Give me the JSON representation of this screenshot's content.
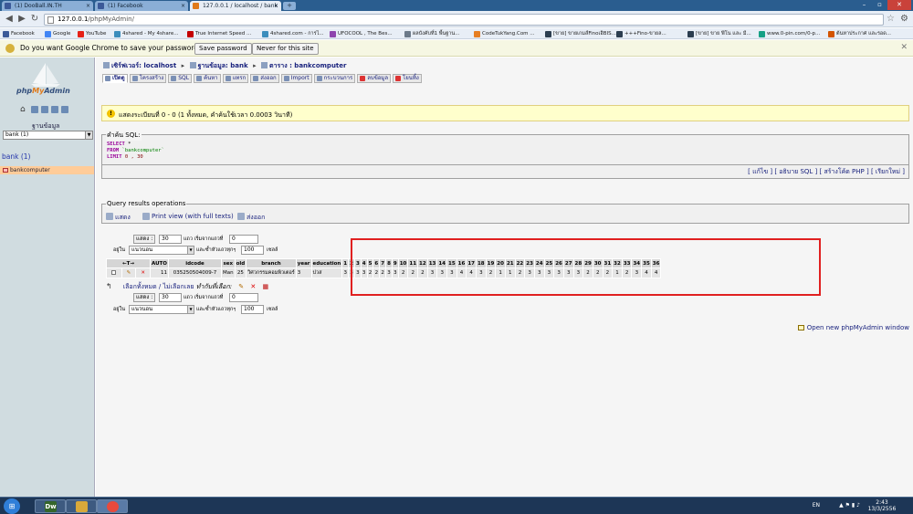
{
  "browser": {
    "tabs": [
      {
        "label": "(1) DooBall.IN.TH",
        "fav": "#3b5998",
        "active": false
      },
      {
        "label": "(1) Facebook",
        "fav": "#3b5998",
        "active": false
      },
      {
        "label": "127.0.0.1 / localhost / bank",
        "fav": "#e07a1a",
        "active": true
      }
    ],
    "url_host": "127.0.0.1",
    "url_path": "/phpMyAdmin/",
    "bookmarks": [
      {
        "label": "Facebook",
        "color": "#3b5998"
      },
      {
        "label": "Google",
        "color": "#4285f4"
      },
      {
        "label": "YouTube",
        "color": "#e62117"
      },
      {
        "label": "4shared - My 4share...",
        "color": "#3c8dbc"
      },
      {
        "label": "True Internet Speed ...",
        "color": "#c40000"
      },
      {
        "label": "4shared.com - การไ...",
        "color": "#3c8dbc"
      },
      {
        "label": "UFOCOOL , The Bes...",
        "color": "#8e44ad"
      },
      {
        "label": "ผลบังคับที่1 พื้นฐาน...",
        "color": "#6c7a89"
      },
      {
        "label": "CodeTukYang.Com ...",
        "color": "#e67e22"
      },
      {
        "label": "[ขาย] ขายเกมส์FinoเฮิBIS...",
        "color": "#2c3e50"
      },
      {
        "label": "+++Fino-ขายล...",
        "color": "#2c3e50"
      },
      {
        "label": "[ขาย] ขาย ฟีโน และ มี...",
        "color": "#2c3e50"
      },
      {
        "label": "www.0-pin.com/0-p...",
        "color": "#16a085"
      },
      {
        "label": "ต้นหาประกาศ และรอด...",
        "color": "#d35400"
      }
    ],
    "infobar": {
      "message": "Do you want Google Chrome to save your password?",
      "save_label": "Save password",
      "never_label": "Never for this site"
    }
  },
  "sidebar": {
    "logo_php": "php",
    "logo_my": "My",
    "logo_admin": "Admin",
    "db_label": "ฐานข้อมูล",
    "db_select_value": "bank (1)",
    "db_link": "bank (1)",
    "table_link": "bankcomputer"
  },
  "breadcrumb": {
    "server": "เซิร์ฟเวอร์: localhost",
    "database": "ฐานข้อมูล: bank",
    "table": "ตาราง : bankcomputer"
  },
  "tabs": [
    {
      "label": "เปิดดู",
      "active": true
    },
    {
      "label": "โครงสร้าง",
      "active": false
    },
    {
      "label": "SQL",
      "active": false
    },
    {
      "label": "ค้นหา",
      "active": false
    },
    {
      "label": "แทรก",
      "active": false
    },
    {
      "label": "ส่งออก",
      "active": false
    },
    {
      "label": "Import",
      "active": false
    },
    {
      "label": "กระบวนการ",
      "active": false
    },
    {
      "label": "ลบข้อมูล",
      "active": false,
      "red": true
    },
    {
      "label": "โยนทิ้ง",
      "active": false,
      "red": true
    }
  ],
  "notice": "แสดงระเบียนที่ 0 - 0 (1 ทั้งหมด, คำค้นใช้เวลา 0.0003 วินาที)",
  "sql_box": {
    "legend": "คำค้น SQL:",
    "select_kw": "SELECT",
    "select_rest": " *",
    "from_kw": "FROM",
    "table": " `bankcomputer`",
    "limit_kw": "LIMIT",
    "limit_vals": " 0 , 30",
    "links": "[ แก้ไข ] [ อธิบาย SQL ] [ สร้างโค้ด PHP ] [ เรียกใหม่ ]"
  },
  "qro": {
    "legend": "Query results operations",
    "show_label": "แสดง",
    "print_label": "Print view (with full texts)",
    "export_label": "ส่งออก"
  },
  "nav": {
    "show_btn": "แสดง :",
    "rows_value": "30",
    "rows_label": "แถว เริ่มจากแถวที่",
    "start_value": "0",
    "mode_prefix": "อยู่ใน",
    "mode_value": "แนวนอน",
    "repeat_label": "และซ้ำหัวแถวทุกๆ",
    "repeat_value": "100",
    "cells_label": "เซลล์"
  },
  "grid": {
    "nav_arrows": "←T→",
    "headers": [
      "AUTO",
      "idcode",
      "sex",
      "old",
      "branch",
      "year",
      "education",
      "1",
      "2",
      "3",
      "4",
      "5",
      "6",
      "7",
      "8",
      "9",
      "10",
      "11",
      "12",
      "13",
      "14",
      "15",
      "16",
      "17",
      "18",
      "19",
      "20",
      "21",
      "22",
      "23",
      "24",
      "25",
      "26",
      "27",
      "28",
      "29",
      "30",
      "31",
      "32",
      "33",
      "34",
      "35",
      "36"
    ],
    "row": [
      "11",
      "035250504009-7",
      "Man",
      "25",
      "วิศวกรรมคอมพิวเตอร์",
      "3",
      "ปวส",
      "3",
      "3",
      "3",
      "3",
      "2",
      "2",
      "2",
      "3",
      "3",
      "2",
      "2",
      "2",
      "3",
      "3",
      "3",
      "4",
      "4",
      "3",
      "2",
      "1",
      "1",
      "2",
      "3",
      "3",
      "3",
      "3",
      "3",
      "3",
      "2",
      "2",
      "2",
      "1",
      "2",
      "3",
      "4",
      "4"
    ]
  },
  "actions": {
    "check_all": "เลือกทั้งหมด",
    "sep": " / ",
    "uncheck_all": "ไม่เลือกเลย",
    "with_selected": "ทำกับที่เลือก:"
  },
  "open_window": "Open new phpMyAdmin window",
  "taskbar": {
    "lang": "EN",
    "time": "2:43",
    "date": "13/3/2556"
  }
}
